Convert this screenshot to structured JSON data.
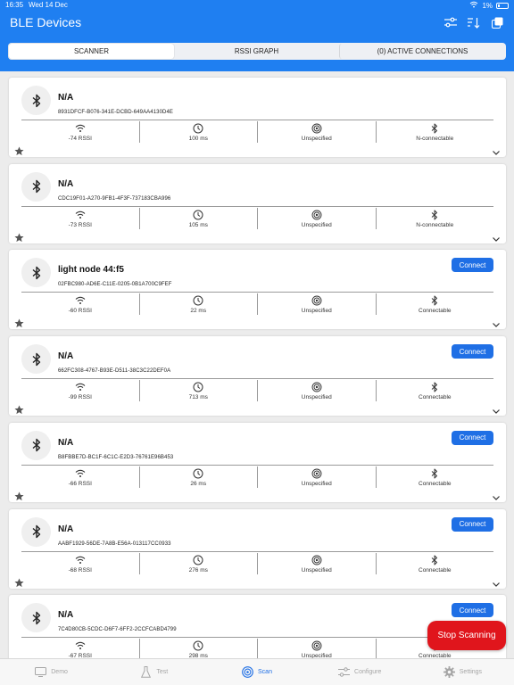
{
  "status_bar": {
    "time": "16:35",
    "date": "Wed 14 Dec",
    "battery": "1%"
  },
  "header": {
    "title": "BLE Devices"
  },
  "tabs": [
    {
      "label": "SCANNER",
      "active": true
    },
    {
      "label": "RSSI GRAPH",
      "active": false
    },
    {
      "label": "(0) ACTIVE CONNECTIONS",
      "active": false
    }
  ],
  "connect_label": "Connect",
  "devices": [
    {
      "name": "N/A",
      "uuid": "8931DFCF-B076-341E-DCBD-649AA4130D4E",
      "rssi": "-74 RSSI",
      "interval": "100 ms",
      "tx": "Unspecified",
      "connectable": "N-connectable",
      "has_connect": false
    },
    {
      "name": "N/A",
      "uuid": "CDC19F01-A270-9FB1-4F3F-737183CBA996",
      "rssi": "-73 RSSI",
      "interval": "105 ms",
      "tx": "Unspecified",
      "connectable": "N-connectable",
      "has_connect": false
    },
    {
      "name": "light node 44:f5",
      "uuid": "02FBC980-AD6E-C11E-0205-0B1A700C9FEF",
      "rssi": "-60 RSSI",
      "interval": "22 ms",
      "tx": "Unspecified",
      "connectable": "Connectable",
      "has_connect": true
    },
    {
      "name": "N/A",
      "uuid": "662FC308-4767-B93E-D511-38C3C22DEF0A",
      "rssi": "-99 RSSI",
      "interval": "713 ms",
      "tx": "Unspecified",
      "connectable": "Connectable",
      "has_connect": true
    },
    {
      "name": "N/A",
      "uuid": "B8FBBE7D-BC1F-6C1C-E2D3-76761E96B453",
      "rssi": "-66 RSSI",
      "interval": "26 ms",
      "tx": "Unspecified",
      "connectable": "Connectable",
      "has_connect": true
    },
    {
      "name": "N/A",
      "uuid": "AABF1929-56DE-7A8B-E56A-013117CC0933",
      "rssi": "-68 RSSI",
      "interval": "276 ms",
      "tx": "Unspecified",
      "connectable": "Connectable",
      "has_connect": true
    },
    {
      "name": "N/A",
      "uuid": "7C4D80CB-5CDC-D6F7-6FF2-2CCFCABD4799",
      "rssi": "-67 RSSI",
      "interval": "298 ms",
      "tx": "Unspecified",
      "connectable": "Connectable",
      "has_connect": true
    }
  ],
  "stop_scanning_label": "Stop Scanning",
  "bottom_tabs": [
    {
      "label": "Demo",
      "icon": "demo-icon",
      "active": false
    },
    {
      "label": "Test",
      "icon": "flask-icon",
      "active": false
    },
    {
      "label": "Scan",
      "icon": "scan-icon",
      "active": true
    },
    {
      "label": "Configure",
      "icon": "sliders-icon",
      "active": false
    },
    {
      "label": "Settings",
      "icon": "gear-icon",
      "active": false
    }
  ],
  "colors": {
    "primary": "#1f7ff1",
    "button": "#1f6fe5",
    "stop": "#e0151c"
  }
}
